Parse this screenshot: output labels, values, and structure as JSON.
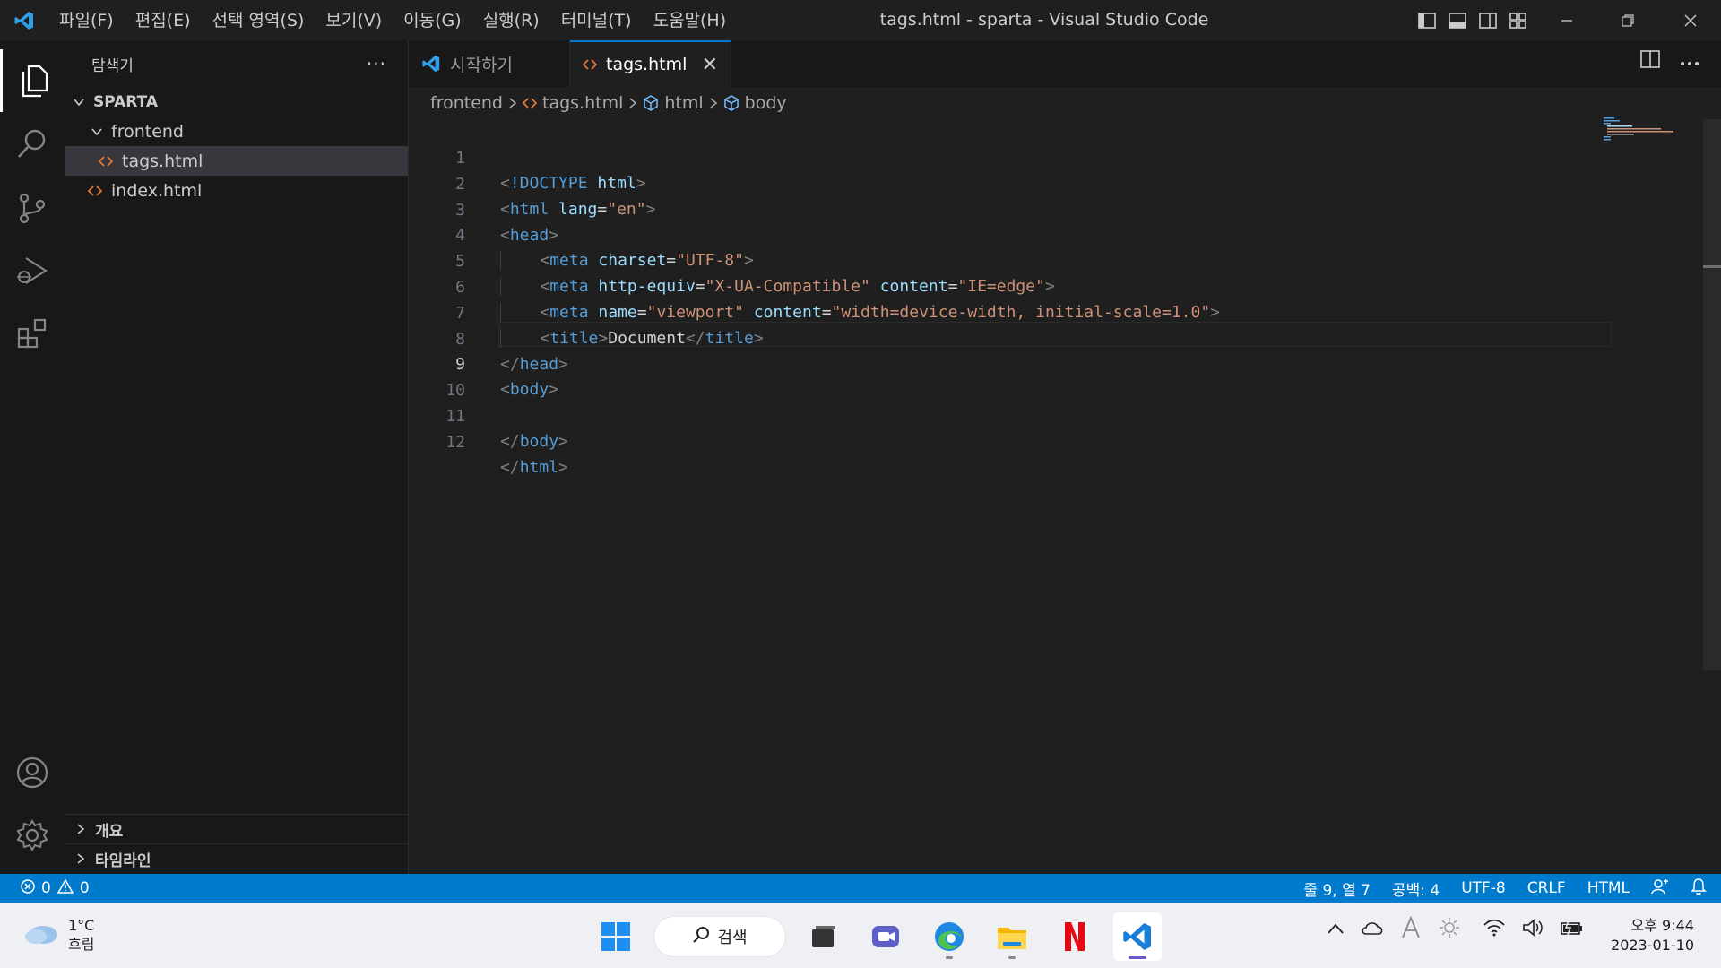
{
  "titlebar": {
    "menu": [
      "파일(F)",
      "편집(E)",
      "선택 영역(S)",
      "보기(V)",
      "이동(G)",
      "실행(R)",
      "터미널(T)",
      "도움말(H)"
    ],
    "window_title": "tags.html - sparta - Visual Studio Code"
  },
  "sidebar": {
    "title": "탐색기",
    "more": "···",
    "root": "SPARTA",
    "tree": [
      {
        "label": "frontend",
        "kind": "folder"
      },
      {
        "label": "tags.html",
        "kind": "file",
        "selected": true
      },
      {
        "label": "index.html",
        "kind": "file"
      }
    ],
    "sections": [
      "개요",
      "타임라인"
    ]
  },
  "tabs": [
    {
      "label": "시작하기",
      "active": false
    },
    {
      "label": "tags.html",
      "active": true,
      "close": "✕"
    }
  ],
  "breadcrumb": [
    "frontend",
    "tags.html",
    "html",
    "body"
  ],
  "editor": {
    "current_line": 9,
    "lines": [
      {
        "n": "1"
      },
      {
        "n": "2"
      },
      {
        "n": "3"
      },
      {
        "n": "4"
      },
      {
        "n": "5"
      },
      {
        "n": "6"
      },
      {
        "n": "7"
      },
      {
        "n": "8"
      },
      {
        "n": "9"
      },
      {
        "n": "10"
      },
      {
        "n": "11"
      },
      {
        "n": "12"
      }
    ],
    "code": {
      "l1": {
        "lt": "<",
        "doctype": "!DOCTYPE",
        "sp": " ",
        "html": "html",
        "gt": ">"
      },
      "l2": {
        "tag": "html",
        "attr": "lang",
        "eq": "=",
        "val": "\"en\""
      },
      "l3": {
        "tag": "head"
      },
      "l4": {
        "tag": "meta",
        "attr": "charset",
        "val": "\"UTF-8\""
      },
      "l5": {
        "tag": "meta",
        "attr1": "http-equiv",
        "val1": "\"X-UA-Compatible\"",
        "attr2": "content",
        "val2": "\"IE=edge\""
      },
      "l6": {
        "tag": "meta",
        "attr1": "name",
        "val1": "\"viewport\"",
        "attr2": "content",
        "val2": "\"width=device-width, initial-scale=1.0\""
      },
      "l7": {
        "tag": "title",
        "text": "Document"
      },
      "l8": {
        "tag": "head"
      },
      "l9": {
        "tag": "body"
      },
      "l11": {
        "tag": "body"
      },
      "l12": {
        "tag": "html"
      }
    }
  },
  "statusbar": {
    "errors": "0",
    "warnings": "0",
    "position": "줄 9, 열 7",
    "spaces": "공백: 4",
    "encoding": "UTF-8",
    "eol": "CRLF",
    "language": "HTML"
  },
  "taskbar": {
    "temp": "1°C",
    "weather": "흐림",
    "search": "검색",
    "time": "오후 9:44",
    "date": "2023-01-10"
  },
  "colors": {
    "accent": "#007acc",
    "tag": "#569cd6",
    "attr": "#9cdcfe",
    "string": "#ce9178",
    "html_file_icon": "#e37933"
  }
}
